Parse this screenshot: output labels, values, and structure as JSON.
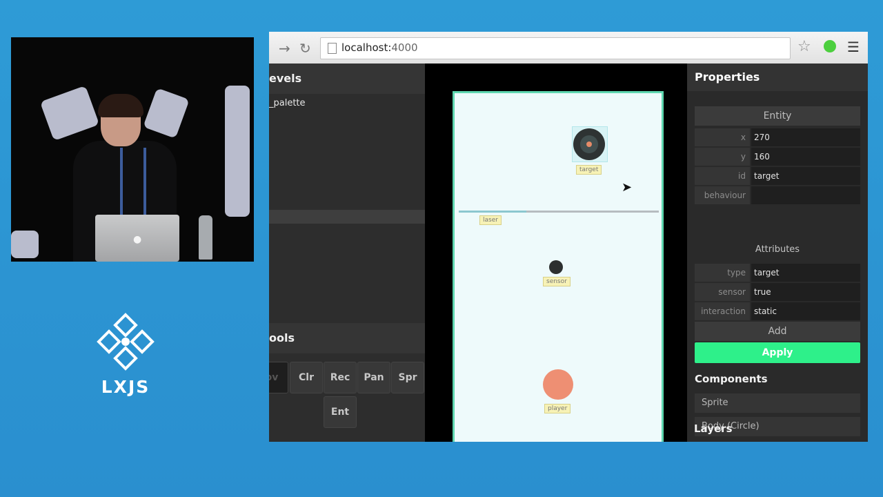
{
  "logo": {
    "word": "LXJS"
  },
  "browser": {
    "url_host": "localhost:",
    "url_port": "4000",
    "icons": [
      "back-arrow-icon",
      "forward-arrow-icon",
      "reload-icon",
      "star-icon",
      "extension-icon",
      "menu-icon"
    ]
  },
  "left_panel": {
    "levels_title": "evels",
    "level_item": "_palette",
    "tools_title": "ools",
    "tool_buttons": [
      "ov",
      "Clr",
      "Rec",
      "Pan",
      "Spr",
      "Ent"
    ]
  },
  "stage": {
    "labels": {
      "target": "target",
      "laser": "laser",
      "sensor": "sensor",
      "player": "player"
    }
  },
  "properties": {
    "title": "Properties",
    "entity_button": "Entity",
    "fields": [
      {
        "key": "x",
        "value": "270"
      },
      {
        "key": "y",
        "value": "160"
      },
      {
        "key": "id",
        "value": "target"
      },
      {
        "key": "behaviour",
        "value": ""
      }
    ],
    "attributes_label": "Attributes",
    "attributes": [
      {
        "key": "type",
        "value": "target"
      },
      {
        "key": "sensor",
        "value": "true"
      },
      {
        "key": "interaction",
        "value": "static"
      }
    ],
    "add_button": "Add",
    "apply_button": "Apply",
    "components_title": "Components",
    "components": [
      "Sprite",
      "Body (Circle)"
    ],
    "layers_title": "Layers"
  },
  "colors": {
    "background": "#2e9bd6",
    "apply_accent": "#2ef08a",
    "stage_border": "#5fd7b0",
    "player": "#ee8f73"
  }
}
